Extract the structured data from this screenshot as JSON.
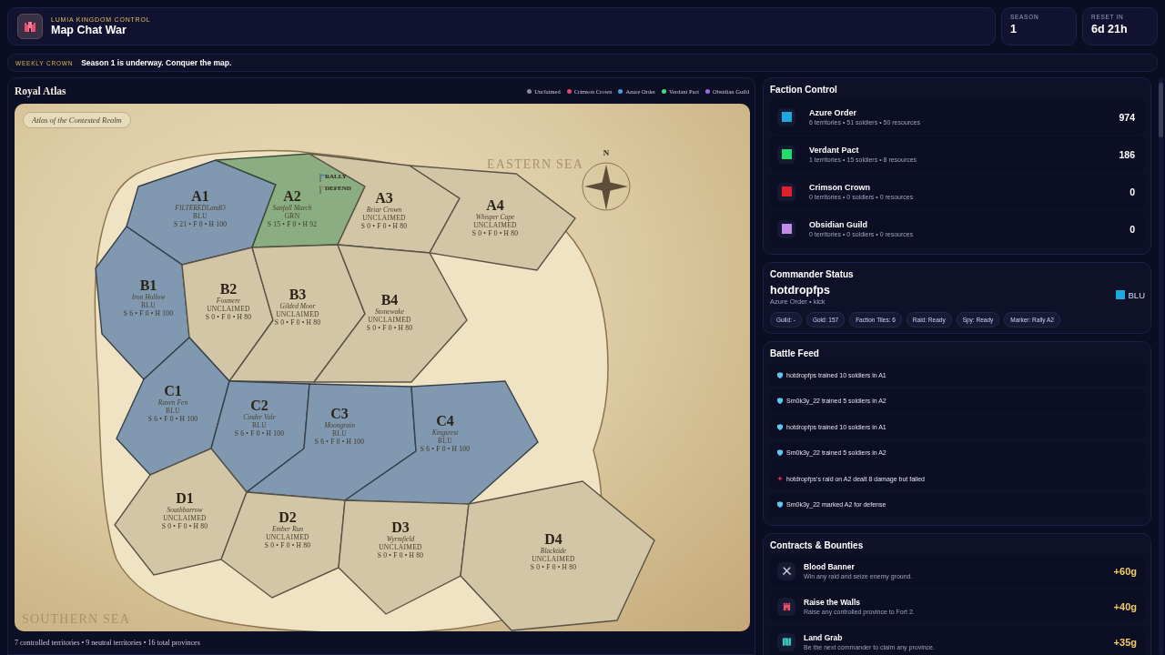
{
  "header": {
    "eyebrow": "LUMIA KINGDOM CONTROL",
    "title": "Map Chat War",
    "stats": [
      {
        "label": "SEASON",
        "value": "1"
      },
      {
        "label": "RESET IN",
        "value": "6d 21h"
      }
    ]
  },
  "banner": {
    "tag": "WEEKLY CROWN",
    "message": "Season 1 is underway. Conquer the map."
  },
  "atlas": {
    "title": "Royal Atlas",
    "legend": [
      {
        "label": "Unclaimed",
        "color": "#8a8e9c"
      },
      {
        "label": "Crimson Crown",
        "color": "#e2486a"
      },
      {
        "label": "Azure Order",
        "color": "#4d9fe0"
      },
      {
        "label": "Verdant Pact",
        "color": "#3fd98a"
      },
      {
        "label": "Obsidian Guild",
        "color": "#9a6ee0"
      }
    ],
    "map": {
      "caption": "Atlas of the Contested Realm",
      "seas": [
        "EASTERN SEA",
        "SOUTHERN SEA"
      ],
      "compass_label": "N",
      "markers": [
        {
          "kind": "rally",
          "label": "RALLY"
        },
        {
          "kind": "defend",
          "label": "DEFEND"
        }
      ],
      "territories": [
        {
          "code": "A1",
          "name": "FILTEREDLandO",
          "owner": "BLU",
          "stats": "S 21 • F 0 • H 100",
          "color": "#8098b0"
        },
        {
          "code": "A2",
          "name": "Sunfall March",
          "owner": "GRN",
          "stats": "S 15 • F 0 • H 92",
          "color": "#8aae82"
        },
        {
          "code": "A3",
          "name": "Briar Crown",
          "owner": "UNCLAIMED",
          "stats": "S 0 • F 0 • H 80",
          "color": "#d3c6a6"
        },
        {
          "code": "A4",
          "name": "Whisper Cape",
          "owner": "UNCLAIMED",
          "stats": "S 0 • F 0 • H 80",
          "color": "#d3c6a6"
        },
        {
          "code": "B1",
          "name": "Iron Hollow",
          "owner": "BLU",
          "stats": "S 6 • F 0 • H 100",
          "color": "#8098b0"
        },
        {
          "code": "B2",
          "name": "Foxmere",
          "owner": "UNCLAIMED",
          "stats": "S 0 • F 0 • H 80",
          "color": "#d3c6a6"
        },
        {
          "code": "B3",
          "name": "Gilded Moor",
          "owner": "UNCLAIMED",
          "stats": "S 0 • F 0 • H 80",
          "color": "#d3c6a6"
        },
        {
          "code": "B4",
          "name": "Stonewake",
          "owner": "UNCLAIMED",
          "stats": "S 0 • F 0 • H 80",
          "color": "#d3c6a6"
        },
        {
          "code": "C1",
          "name": "Raven Fen",
          "owner": "BLU",
          "stats": "S 6 • F 0 • H 100",
          "color": "#8098b0"
        },
        {
          "code": "C2",
          "name": "Cinder Vale",
          "owner": "BLU",
          "stats": "S 6 • F 0 • H 100",
          "color": "#8098b0"
        },
        {
          "code": "C3",
          "name": "Moongrain",
          "owner": "BLU",
          "stats": "S 6 • F 0 • H 100",
          "color": "#8098b0"
        },
        {
          "code": "C4",
          "name": "Kingsrest",
          "owner": "BLU",
          "stats": "S 6 • F 0 • H 100",
          "color": "#8098b0"
        },
        {
          "code": "D1",
          "name": "Southbarrow",
          "owner": "UNCLAIMED",
          "stats": "S 0 • F 0 • H 80",
          "color": "#d3c6a6"
        },
        {
          "code": "D2",
          "name": "Ember Run",
          "owner": "UNCLAIMED",
          "stats": "S 0 • F 0 • H 80",
          "color": "#d3c6a6"
        },
        {
          "code": "D3",
          "name": "Wyrmfield",
          "owner": "UNCLAIMED",
          "stats": "S 0 • F 0 • H 80",
          "color": "#d3c6a6"
        },
        {
          "code": "D4",
          "name": "Blacktide",
          "owner": "UNCLAIMED",
          "stats": "S 0 • F 0 • H 80",
          "color": "#d3c6a6"
        }
      ]
    },
    "summary": "7 controlled territories • 9 neutral territories • 16 total provinces"
  },
  "faction_control": {
    "title": "Faction Control",
    "factions": [
      {
        "name": "Azure Order",
        "stats": "6 territories • 51 soldiers • 50 resources",
        "score": "974",
        "color": "#1ea8e0"
      },
      {
        "name": "Verdant Pact",
        "stats": "1 territories • 15 soldiers • 8 resources",
        "score": "186",
        "color": "#22dd6a"
      },
      {
        "name": "Crimson Crown",
        "stats": "0 territories • 0 soldiers • 0 resources",
        "score": "0",
        "color": "#e0202e"
      },
      {
        "name": "Obsidian Guild",
        "stats": "0 territories • 0 soldiers • 0 resources",
        "score": "0",
        "color": "#c38ce8"
      }
    ]
  },
  "commander": {
    "title": "Commander Status",
    "name": "hotdropfps",
    "subtitle": "Azure Order • kick",
    "faction_code": "BLU",
    "chips": [
      "Guild: -",
      "Gold: 157",
      "Faction Tiles: 6",
      "Raid: Ready",
      "Spy: Ready",
      "Marker: Rally A2"
    ]
  },
  "battle_feed": {
    "title": "Battle Feed",
    "events": [
      {
        "kind": "defend",
        "text": "hotdropfps trained 10 soldiers in A1"
      },
      {
        "kind": "defend",
        "text": "Sm0k3y_22 trained 5 soldiers in A2"
      },
      {
        "kind": "defend",
        "text": "hotdropfps trained 10 soldiers in A1"
      },
      {
        "kind": "defend",
        "text": "Sm0k3y_22 trained 5 soldiers in A2"
      },
      {
        "kind": "raid",
        "text": "hotdropfps's raid on A2 dealt 8 damage but failed"
      },
      {
        "kind": "defend",
        "text": "Sm0k3y_22 marked A2 for defense"
      }
    ]
  },
  "contracts": {
    "title": "Contracts & Bounties",
    "items": [
      {
        "kind": "swords",
        "title": "Blood Banner",
        "description": "Win any raid and seize enemy ground.",
        "reward": "+60g"
      },
      {
        "kind": "tower",
        "title": "Raise the Walls",
        "description": "Raise any controlled province to Fort 2.",
        "reward": "+40g"
      },
      {
        "kind": "map",
        "title": "Land Grab",
        "description": "Be the next commander to claim any province.",
        "reward": "+35g"
      }
    ]
  }
}
